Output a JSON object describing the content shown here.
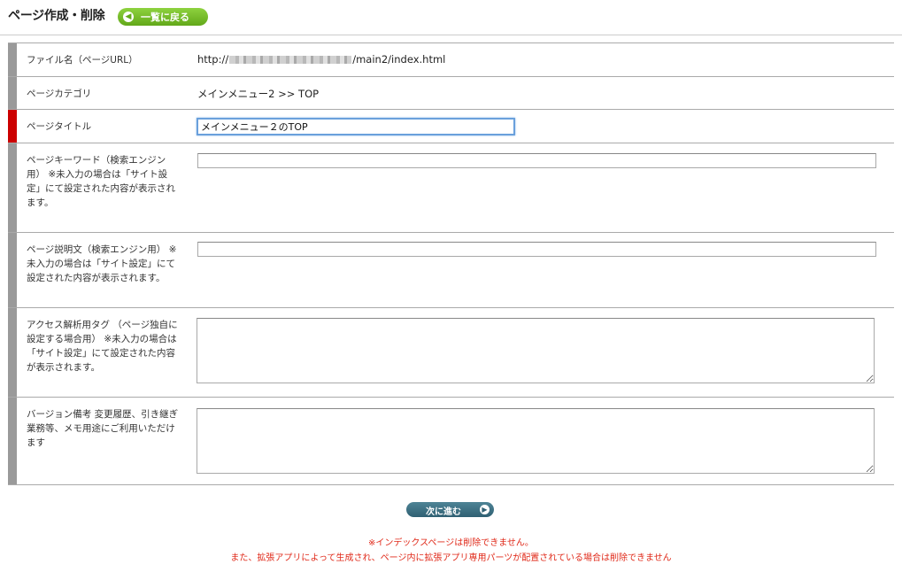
{
  "header": {
    "title": "ページ作成・削除",
    "back_button_label": "一覧に戻る",
    "back_icon": "arrow-left-circle-icon"
  },
  "form": {
    "file_name": {
      "label": "ファイル名（ページURL）",
      "url_prefix": "http://",
      "url_suffix": "/main2/index.html"
    },
    "category": {
      "label": "ページカテゴリ",
      "value": "メインメニュー2 >> TOP"
    },
    "title": {
      "label": "ページタイトル",
      "value": "メインメニュー２のTOP"
    },
    "keywords": {
      "label": "ページキーワード（検索エンジン用）\n※未入力の場合は「サイト設定」にて設定された内容が表示されます。",
      "value": ""
    },
    "description": {
      "label": "ページ説明文（検索エンジン用）\n※未入力の場合は「サイト設定」にて設定された内容が表示されます。",
      "value": ""
    },
    "analytics": {
      "label": "アクセス解析用タグ\n（ページ独自に設定する場合用）\n※未入力の場合は「サイト設定」にて設定された内容が表示されます。",
      "value": ""
    },
    "version_notes": {
      "label": "バージョン備考\n変更履歴、引き継ぎ業務等、メモ用途にご利用いただけます",
      "value": ""
    }
  },
  "footer": {
    "next_button_label": "次に進む",
    "next_icon": "arrow-right-circle-icon",
    "notice_line1": "※インデックスページは削除できません。",
    "notice_line2": "また、拡張アプリによって生成され、ページ内に拡張アプリ専用パーツが配置されている場合は削除できません"
  },
  "colors": {
    "required_bar": "#cc0000",
    "normal_bar": "#9a9a9a",
    "back_button": "#62a819",
    "next_button": "#2f6073",
    "notice_text": "#e02a1a"
  }
}
